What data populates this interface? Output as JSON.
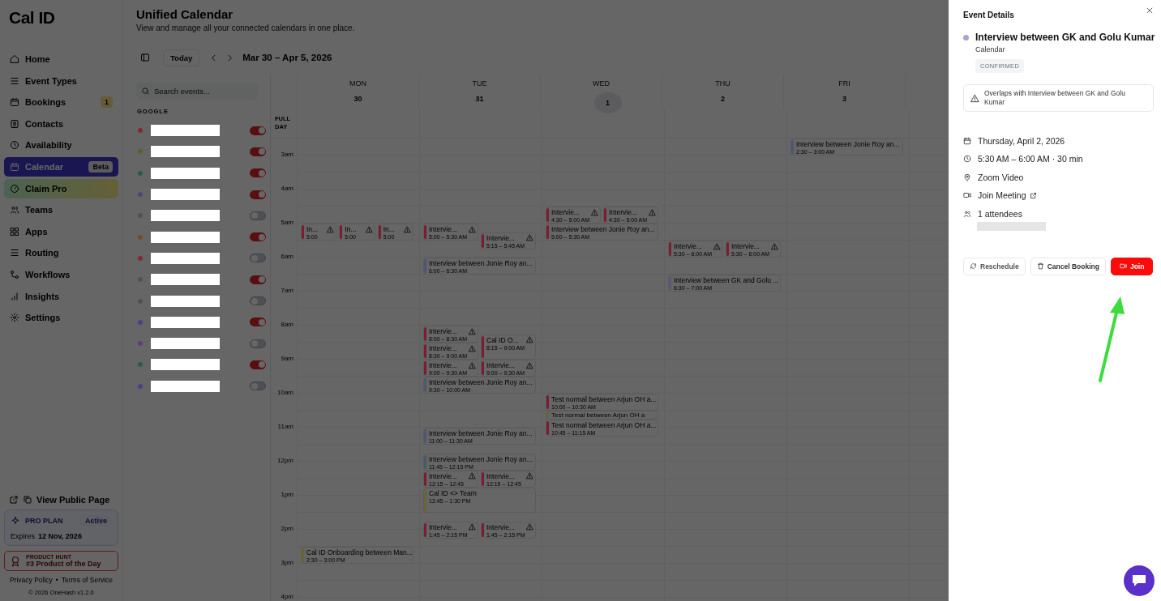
{
  "sidebar": {
    "logo": "Cal ID",
    "nav": [
      {
        "label": "Home",
        "selected": false,
        "kind": "link"
      },
      {
        "label": "Event Types",
        "selected": false,
        "kind": "link"
      },
      {
        "label": "Bookings",
        "selected": false,
        "kind": "link",
        "badge": "1"
      },
      {
        "label": "Contacts",
        "selected": false,
        "kind": "link"
      },
      {
        "label": "Availability",
        "selected": false,
        "kind": "link"
      },
      {
        "label": "Calendar",
        "selected": true,
        "kind": "link",
        "badge": "Beta"
      },
      {
        "label": "Claim Pro",
        "selected": false,
        "kind": "promo"
      },
      {
        "label": "Teams",
        "selected": false,
        "kind": "link"
      },
      {
        "label": "Apps",
        "selected": false,
        "kind": "link"
      },
      {
        "label": "Routing",
        "selected": false,
        "kind": "link"
      },
      {
        "label": "Workflows",
        "selected": false,
        "kind": "link"
      },
      {
        "label": "Insights",
        "selected": false,
        "kind": "link"
      },
      {
        "label": "Settings",
        "selected": false,
        "kind": "link"
      }
    ],
    "public_page": "View Public Page",
    "plan": {
      "name": "PRO PLAN",
      "status": "Active",
      "expires_label": "Expires",
      "expires": "12 Nov, 2026"
    },
    "product_hunt": {
      "caption": "PRODUCT HUNT",
      "title": "#3 Product of the Day"
    },
    "footer": {
      "links": [
        "Privacy Policy",
        "Terms of Service"
      ],
      "separator": "•",
      "copyright": "© 2026 OneHash v1.2.0"
    }
  },
  "page": {
    "title": "Unified Calendar",
    "subtitle": "View and manage all your connected calendars in one place."
  },
  "toolbar": {
    "today": "Today",
    "range": "Mar 30 – Apr 5, 2026"
  },
  "calendars": {
    "search_placeholder": "Search events...",
    "group": "GOOGLE",
    "items": [
      {
        "color": "#7d2a3a",
        "on": true
      },
      {
        "color": "#5f5f2a",
        "on": true
      },
      {
        "color": "#2b5d47",
        "on": true
      },
      {
        "color": "#56437e",
        "on": true
      },
      {
        "color": "#505257",
        "on": false
      },
      {
        "color": "#7a4a30",
        "on": true
      },
      {
        "color": "#7d2a3a",
        "on": false
      },
      {
        "color": "#505257",
        "on": true
      },
      {
        "color": "#505257",
        "on": false
      },
      {
        "color": "#45458a",
        "on": true
      },
      {
        "color": "#5c3f80",
        "on": false
      },
      {
        "color": "#2b5d47",
        "on": true
      },
      {
        "color": "#45458a",
        "on": false
      }
    ]
  },
  "week": {
    "full_day_label": "FULL DAY",
    "hours": [
      "3am",
      "4am",
      "5am",
      "6am",
      "7am",
      "8am",
      "9am",
      "10am",
      "11am",
      "12pm",
      "1pm",
      "2pm",
      "3pm",
      "4pm"
    ],
    "days": [
      {
        "weekday": "MON",
        "date": "30",
        "today": false,
        "blocks": [
          {
            "lanes": [
              [
                {
                  "title": "In...",
                  "time": "5:00",
                  "color": "#7d1c30",
                  "overlap": true
                }
              ],
              [
                {
                  "title": "In...",
                  "time": "5:00",
                  "color": "#7d1c30",
                  "overlap": true
                }
              ],
              [
                {
                  "title": "In...",
                  "time": "5:00",
                  "color": "#7d1c30",
                  "overlap": true
                }
              ]
            ]
          },
          {
            "lanes": [
              [
                {
                  "title": "Cal ID Onboarding between Man...",
                  "time": "2:30 – 3:00 PM",
                  "color": "#6b6433",
                  "overlap": false
                }
              ]
            ]
          }
        ]
      },
      {
        "weekday": "TUE",
        "date": "31",
        "today": false,
        "blocks": [
          {
            "lanes": [
              [
                {
                  "title": "Intervie...",
                  "time": "5:00 – 5:30 AM",
                  "color": "#7d1c30",
                  "overlap": true
                }
              ],
              [
                {
                  "title": "Intervie...",
                  "time": "5:15 – 5:45 AM",
                  "color": "#7d1c30",
                  "overlap": true
                }
              ]
            ]
          },
          {
            "lanes": [
              [
                {
                  "title": "Interview between Jonie Roy an...",
                  "time": "6:00 – 6:30 AM",
                  "color": "#4d5672",
                  "overlap": false
                }
              ]
            ]
          },
          {
            "lanes": [
              [
                {
                  "title": "Intervie...",
                  "time": "8:00 – 8:30 AM",
                  "color": "#7d1c30",
                  "overlap": true
                },
                {
                  "title": "Intervie...",
                  "time": "8:30 – 9:00 AM",
                  "color": "#7d1c30",
                  "overlap": true
                },
                {
                  "title": "Intervie...",
                  "time": "9:00 – 9:30 AM",
                  "color": "#7d1c30",
                  "overlap": true
                }
              ],
              [
                {
                  "title": "Cal ID O...",
                  "time": "8:15 – 9:00 AM",
                  "color": "#7d1c30",
                  "overlap": true
                },
                {
                  "title": "Intervie...",
                  "time": "9:00 – 9:30 AM",
                  "color": "#7d1c30",
                  "overlap": true
                }
              ]
            ]
          },
          {
            "lanes": [
              [
                {
                  "title": "Interview between Jonie Roy an...",
                  "time": "9:30 – 10:00 AM",
                  "color": "#4d5672",
                  "overlap": false
                }
              ]
            ]
          },
          {
            "lanes": [
              [
                {
                  "title": "Interview between Jonie Roy an...",
                  "time": "11:00 – 11:30 AM",
                  "color": "#4d5672",
                  "overlap": false
                }
              ]
            ]
          },
          {
            "lanes": [
              [
                {
                  "title": "Interview between Jonie Roy an...",
                  "time": "11:45 – 12:15 PM",
                  "color": "#4d5672",
                  "overlap": false
                }
              ]
            ]
          },
          {
            "lanes": [
              [
                {
                  "title": "Intervie...",
                  "time": "12:15 – 12:45",
                  "color": "#7d1c30",
                  "overlap": true
                }
              ],
              [
                {
                  "title": "Intervie...",
                  "time": "12:15 – 12:45",
                  "color": "#7d1c30",
                  "overlap": true
                }
              ]
            ]
          },
          {
            "lanes": [
              [
                {
                  "title": "Cal ID <> Team",
                  "time": "12:45 – 1:30 PM",
                  "color": "#6b6433",
                  "overlap": false
                }
              ]
            ]
          },
          {
            "lanes": [
              [
                {
                  "title": "Intervie...",
                  "time": "1:45 – 2:15 PM",
                  "color": "#7d1c30",
                  "overlap": true
                }
              ],
              [
                {
                  "title": "Intervie...",
                  "time": "1:45 – 2:15 PM",
                  "color": "#7d1c30",
                  "overlap": true
                }
              ]
            ]
          }
        ]
      },
      {
        "weekday": "WED",
        "date": "1",
        "today": true,
        "blocks": [
          {
            "lanes": [
              [
                {
                  "title": "Intervie...",
                  "time": "4:30 – 5:00 AM",
                  "color": "#7d1c30",
                  "overlap": true
                }
              ],
              [
                {
                  "title": "Intervie...",
                  "time": "4:30 – 5:00 AM",
                  "color": "#7d1c30",
                  "overlap": true
                }
              ]
            ]
          },
          {
            "lanes": [
              [
                {
                  "title": "Interview between Jonie Roy an...",
                  "time": "5:00 – 5:30 AM",
                  "color": "#7d1c30",
                  "overlap": false
                }
              ]
            ]
          },
          {
            "lanes": [
              [
                {
                  "title": "Test normal between Arjun OH a...",
                  "time": "10:00 – 10:30 AM",
                  "color": "#7d1c30",
                  "overlap": false
                },
                {
                  "title": "Test normal between Arjun OH a",
                  "color": "#6b6433",
                  "overlap": false
                }
              ]
            ]
          },
          {
            "lanes": [
              [
                {
                  "title": "Test normal between Arjun OH a...",
                  "time": "10:45 – 11:15 AM",
                  "color": "#7d1c30",
                  "overlap": false
                }
              ]
            ]
          }
        ]
      },
      {
        "weekday": "THU",
        "date": "2",
        "today": false,
        "blocks": [
          {
            "lanes": [
              [
                {
                  "title": "Intervie...",
                  "time": "5:30 – 6:00 AM",
                  "color": "#7d1c30",
                  "overlap": true
                }
              ],
              [
                {
                  "title": "Intervie...",
                  "time": "5:30 – 6:00 AM",
                  "color": "#7d1c30",
                  "overlap": true
                }
              ]
            ]
          },
          {
            "lanes": [
              [
                {
                  "title": "Interview between GK and Golu ...",
                  "time": "6:30 – 7:00 AM",
                  "color": "#5a587a",
                  "overlap": false
                }
              ]
            ]
          }
        ]
      },
      {
        "weekday": "FRI",
        "date": "3",
        "today": false,
        "blocks": [
          {
            "lanes": [
              [
                {
                  "title": "Interview between Jonie Roy an...",
                  "time": "2:30 – 3:00 AM",
                  "color": "#4d5672",
                  "overlap": false
                }
              ]
            ]
          }
        ]
      }
    ]
  },
  "details": {
    "heading": "Event Details",
    "title": "Interview between GK and Golu Kumar",
    "color": "#a5a3d6",
    "calendar": "Calendar",
    "status": "CONFIRMED",
    "warning": "Overlaps with Interview between GK and Golu Kumar",
    "rows": [
      {
        "kind": "date",
        "text": "Thursday, April 2, 2026"
      },
      {
        "kind": "time",
        "text": "5:30 AM – 6:00 AM · 30 min"
      },
      {
        "kind": "location",
        "text": "Zoom Video"
      },
      {
        "kind": "link",
        "text": "Join Meeting"
      },
      {
        "kind": "attendees",
        "text": "1 attendees"
      }
    ],
    "actions": [
      {
        "kind": "reschedule",
        "label": "Reschedule"
      },
      {
        "kind": "cancel",
        "label": "Cancel Booking"
      },
      {
        "kind": "join",
        "label": "Join"
      }
    ]
  }
}
